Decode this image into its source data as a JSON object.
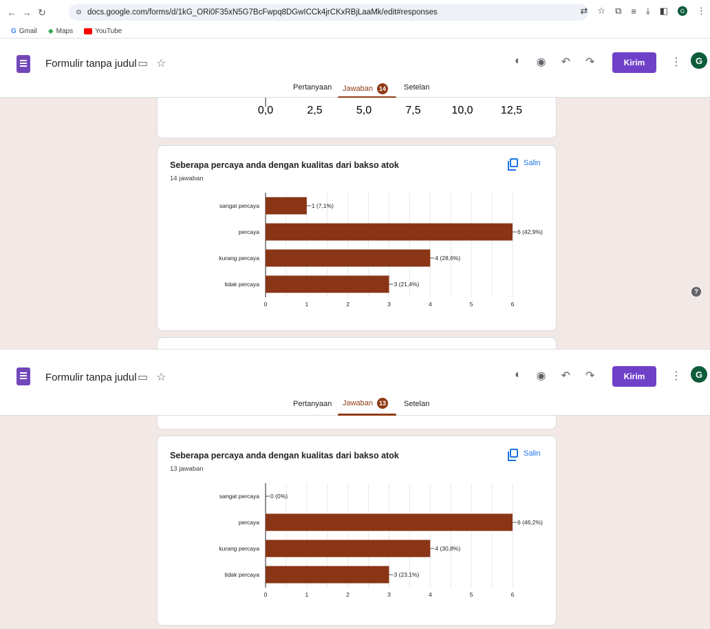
{
  "browser": {
    "url": "docs.google.com/forms/d/1kG_ORi0F35xN5G7BcFwpq8DGwICCk4jrCKxRBjLaaMk/edit#responses",
    "bookmarks": [
      "Gmail",
      "Maps",
      "YouTube"
    ],
    "profile_initial": "G"
  },
  "app": {
    "form_title": "Formulir tanpa judul",
    "send_label": "Kirim",
    "avatar_initial": "G",
    "tabs": [
      "Pertanyaan",
      "Jawaban",
      "Setelan"
    ]
  },
  "top_partial_axis": {
    "ticks": [
      "0,0",
      "2,5",
      "5,0",
      "7,5",
      "10,0",
      "12,5"
    ]
  },
  "panels": [
    {
      "response_badge": "14",
      "question": "Seberapa percaya anda dengan kualitas dari bakso atok",
      "count_label": "14 jawaban",
      "copy_label": "Salin"
    },
    {
      "response_badge": "13",
      "question": "Seberapa percaya anda dengan kualitas dari bakso atok",
      "count_label": "13 jawaban",
      "copy_label": "Salin"
    }
  ],
  "chart_data": [
    {
      "type": "bar",
      "orientation": "horizontal",
      "categories": [
        "sangat percaya",
        "percaya",
        "kurang percaya",
        "tidak percaya"
      ],
      "values": [
        1,
        6,
        4,
        3
      ],
      "labels": [
        "1 (7,1%)",
        "6 (42,9%)",
        "4 (28,6%)",
        "3 (21,4%)"
      ],
      "xlim": [
        0,
        6
      ],
      "xticks": [
        "0",
        "1",
        "2",
        "3",
        "4",
        "5",
        "6"
      ],
      "color": "#8a3516",
      "grid": true
    },
    {
      "type": "bar",
      "orientation": "horizontal",
      "categories": [
        "sangat percaya",
        "percaya",
        "kurang percaya",
        "tidak percaya"
      ],
      "values": [
        0,
        6,
        4,
        3
      ],
      "labels": [
        "0 (0%)",
        "6 (46,2%)",
        "4 (30,8%)",
        "3 (23,1%)"
      ],
      "xlim": [
        0,
        6
      ],
      "xticks": [
        "0",
        "1",
        "2",
        "3",
        "4",
        "5",
        "6"
      ],
      "color": "#8a3516",
      "grid": true
    }
  ]
}
